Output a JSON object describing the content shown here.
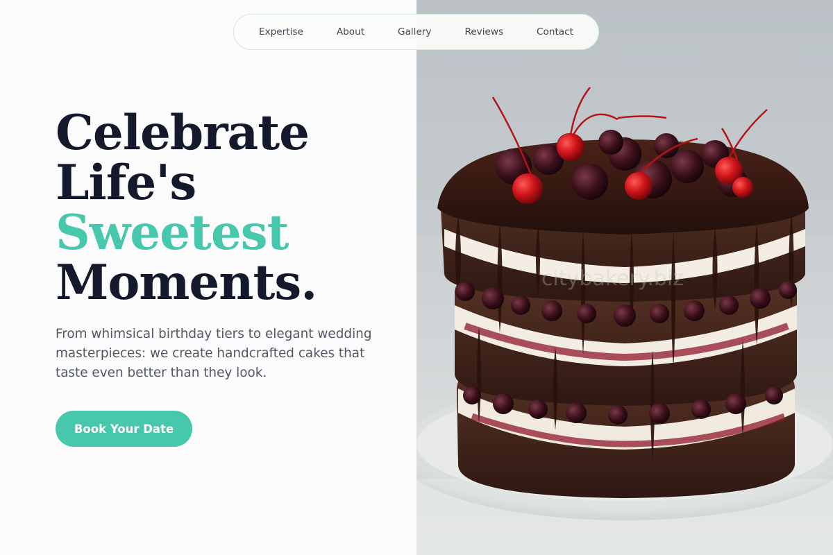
{
  "nav": {
    "items": [
      {
        "label": "Expertise"
      },
      {
        "label": "About"
      },
      {
        "label": "Gallery"
      },
      {
        "label": "Reviews"
      },
      {
        "label": "Contact"
      }
    ]
  },
  "hero": {
    "headline": {
      "line1": "Celebrate",
      "line2": "Life's",
      "line3": "Sweetest",
      "line4": "Moments."
    },
    "description": "From whimsical birthday tiers to elegant wedding masterpieces: we create handcrafted cakes that taste even better than they look.",
    "cta_label": "Book Your Date"
  },
  "photo": {
    "watermark": "citybakery.biz"
  },
  "colors": {
    "accent": "#47c7ac",
    "heading": "#141a2b",
    "body_text": "#515866",
    "background": "#fcfbfb"
  }
}
